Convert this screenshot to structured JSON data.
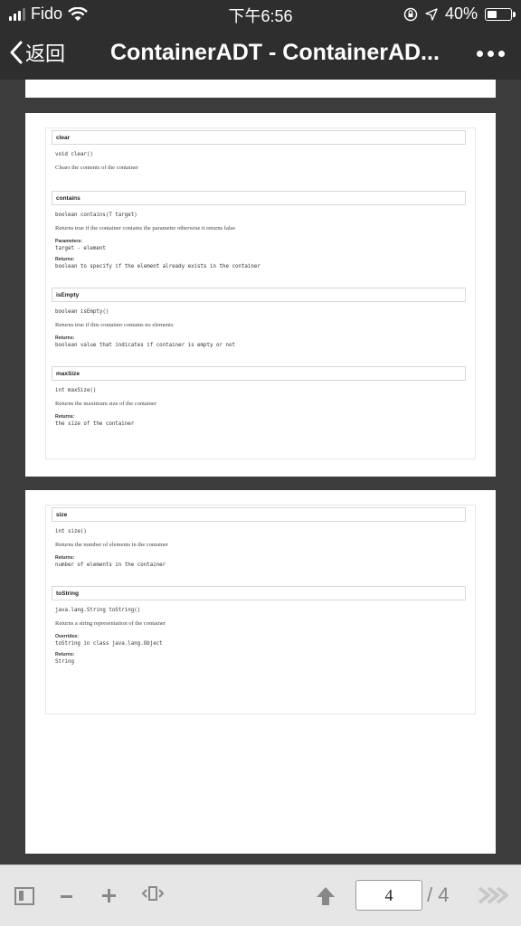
{
  "status": {
    "carrier": "Fido",
    "time": "下午6:56",
    "battery": "40%",
    "battery_level": 0.4
  },
  "nav": {
    "back_label": "返回",
    "title": "ContainerADT - ContainerAD..."
  },
  "methods_page3": [
    {
      "name": "clear",
      "signature": "void clear()",
      "description": "Clears the contents of the container",
      "details": []
    },
    {
      "name": "contains",
      "signature": "boolean contains(T target)",
      "description": "Returns true if the container contains the parameter otherwise it returns false",
      "details": [
        {
          "label": "Parameters:",
          "value": "target - element"
        },
        {
          "label": "Returns:",
          "value": "boolean to specify if the element already exists in the container"
        }
      ]
    },
    {
      "name": "isEmpty",
      "signature": "boolean isEmpty()",
      "description": "Returns true if this container contains no elements",
      "details": [
        {
          "label": "Returns:",
          "value": "boolean value that indicates if container is empty or not"
        }
      ]
    },
    {
      "name": "maxSize",
      "signature": "int maxSize()",
      "description": "Returns the maximum size of the container",
      "details": [
        {
          "label": "Returns:",
          "value": "the size of the container"
        }
      ]
    }
  ],
  "methods_page4": [
    {
      "name": "size",
      "signature": "int size()",
      "description": "Returns the number of elements in the container",
      "details": [
        {
          "label": "Returns:",
          "value": "number of elements in the container"
        }
      ]
    },
    {
      "name": "toString",
      "signature": "java.lang.String toString()",
      "description": "Returns a string representation of the container",
      "details": [
        {
          "label": "Overrides:",
          "value": "toString in class java.lang.Object"
        },
        {
          "label": "Returns:",
          "value": "String"
        }
      ]
    }
  ],
  "toolbar": {
    "current_page": "4",
    "total_pages": "/ 4"
  },
  "icons": {
    "sidebar": "sidebar-toggle-icon",
    "zoom_out": "minus-icon",
    "zoom_in": "plus-icon",
    "fit": "fit-width-icon",
    "previous": "arrow-up-icon",
    "next": "fast-forward-icon"
  }
}
